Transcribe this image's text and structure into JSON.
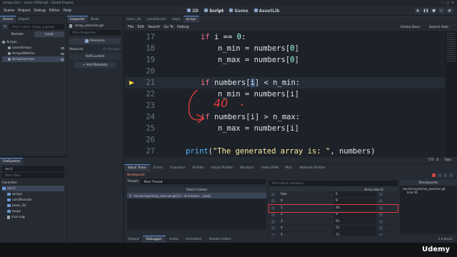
{
  "window": {
    "title": "arrays.tscn - Learn GDScript - Godot Engine"
  },
  "menu": [
    "Scene",
    "Project",
    "Debug",
    "Editor",
    "Help"
  ],
  "workspaces": [
    "2D",
    "Script",
    "Game",
    "AssetLib"
  ],
  "scene_dock": {
    "tabs": [
      "Scene",
      "Import"
    ],
    "filter_placeholder": "Filter: name, t:type, g:group",
    "remote": "Remote",
    "local": "Local",
    "root": "Arrays",
    "children": [
      "LearnArrays",
      "ArraysWithFor",
      "ArrayExercise"
    ]
  },
  "filesystem": {
    "title": "FileSystem",
    "path": "res://",
    "filter_placeholder": "Filter Files",
    "items": [
      "Favorites:",
      "res://",
      "arrays",
      "conditionals",
      "learn_3d",
      "loops",
      "icon.svg"
    ]
  },
  "inspector": {
    "tabs": [
      "Inspector",
      "Node"
    ],
    "file": "array_exercise.gd",
    "filter_placeholder": "Filter Properties",
    "resource": "Resource",
    "section": "Resource",
    "changes": "(2 changes)",
    "refcounted": "RefCounted",
    "add_metadata": "Add Metadata"
  },
  "editor_tabs": [
    "learn_3d",
    "conditionals",
    "loops",
    "arrays"
  ],
  "script_menu": [
    "File",
    "Edit",
    "Search",
    "Go To",
    "Debug"
  ],
  "script_right": {
    "docs": "Online Docs",
    "search_help": "Search Help"
  },
  "code": [
    {
      "n": "17",
      "t": "if_i"
    },
    {
      "n": "18",
      "t": "min0"
    },
    {
      "n": "19",
      "t": "max0"
    },
    {
      "n": "20",
      "t": "blank"
    },
    {
      "n": "21",
      "t": "if_min"
    },
    {
      "n": "22",
      "t": "min_i"
    },
    {
      "n": "23",
      "t": "blank"
    },
    {
      "n": "24",
      "t": "if_max"
    },
    {
      "n": "25",
      "t": "max_i"
    },
    {
      "n": "26",
      "t": "blank"
    },
    {
      "n": "27",
      "t": "print"
    }
  ],
  "code_text": {
    "if": "if",
    "i": "i",
    "eq": " == ",
    "zero": "0",
    "colon": ":",
    "n_min": "n_min = numbers[",
    "n_max": "n_max = numbers[",
    "close": "]",
    "numbers": "numbers[",
    "lt": "] < n_min:",
    "gt": "] > n_max:",
    "print": "print",
    "str": "\"The generated array is: \"",
    "print_tail": ", numbers)",
    "print_open": "("
  },
  "annotation": "40",
  "status": {
    "position": "175 :  6",
    "format": "Tabs"
  },
  "debugger": {
    "tabs": [
      "Stack Trace",
      "Errors",
      "Evaluator",
      "Profiler",
      "Visual Profiler",
      "Monitors",
      "Video RAM",
      "Misc",
      "Network Profiler"
    ],
    "state": "Breakpoint",
    "thread_label": "Thread:",
    "thread": "Main Thread",
    "frames_header": "Stack Frames",
    "frame": "0 - res://arrays/array_exercise.gd:21 - at function: _ready",
    "filter_vars": "Filter Stack Variables",
    "var_header": "Array (size 6)",
    "rows": [
      {
        "k": "Size",
        "v": "6"
      },
      {
        "k": "0",
        "v": "9"
      },
      {
        "k": "1",
        "v": "40"
      },
      {
        "k": "2",
        "v": "9"
      },
      {
        "k": "3",
        "v": "91"
      },
      {
        "k": "4",
        "v": "52"
      },
      {
        "k": "5",
        "v": "71"
      }
    ],
    "breakpoints_title": "Breakpoints",
    "breakpoint_file": "res://arrays/array_exercise.gd",
    "breakpoint_line": "Line 16"
  },
  "bottom_tabs": [
    "Output",
    "Debugger",
    "Audio",
    "Animation",
    "Shader Editor"
  ],
  "version": "4.4.beta2",
  "watermark": "Udemy",
  "colors": {
    "accent": "#5b93d8",
    "keyword": "#ff7085",
    "number": "#a1ffe0",
    "string": "#ffeda1",
    "function": "#57b3ff",
    "pen": "#e23b3b"
  }
}
